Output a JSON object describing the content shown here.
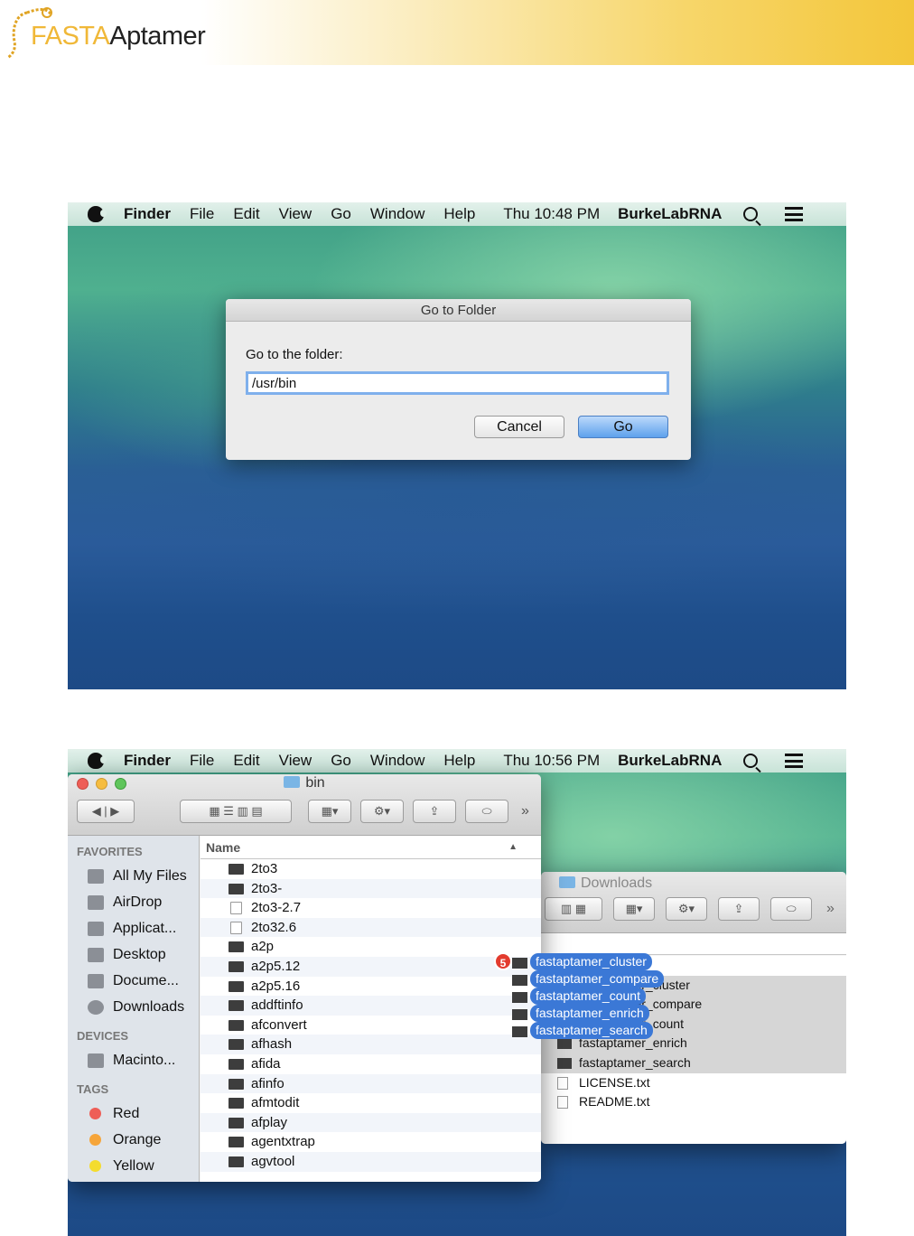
{
  "header": {
    "logo_part1": "FASTA",
    "logo_part2": "ptamer",
    "logo_a": "A"
  },
  "shot1": {
    "menubar": {
      "app": "Finder",
      "items": [
        "File",
        "Edit",
        "View",
        "Go",
        "Window",
        "Help"
      ],
      "clock": "Thu 10:48 PM",
      "user": "BurkeLabRNA"
    },
    "dialog": {
      "title": "Go to Folder",
      "label": "Go to the folder:",
      "value": "/usr/bin",
      "cancel": "Cancel",
      "go": "Go"
    }
  },
  "shot2": {
    "menubar": {
      "app": "Finder",
      "items": [
        "File",
        "Edit",
        "View",
        "Go",
        "Window",
        "Help"
      ],
      "clock": "Thu 10:56 PM",
      "user": "BurkeLabRNA"
    },
    "finder": {
      "title": "bin",
      "favorites_label": "FAVORITES",
      "favorites": [
        "All My Files",
        "AirDrop",
        "Applicat...",
        "Desktop",
        "Docume...",
        "Downloads"
      ],
      "devices_label": "DEVICES",
      "devices": [
        "Macinto..."
      ],
      "tags_label": "TAGS",
      "tags": [
        {
          "name": "Red",
          "color": "#ee5e57"
        },
        {
          "name": "Orange",
          "color": "#f6a53a"
        },
        {
          "name": "Yellow",
          "color": "#f4dc2e"
        }
      ],
      "column": "Name",
      "files": [
        "2to3",
        "2to3-",
        "2to3-2.7",
        "2to32.6",
        "a2p",
        "a2p5.12",
        "a2p5.16",
        "addftinfo",
        "afconvert",
        "afhash",
        "afida",
        "afinfo",
        "afmtodit",
        "afplay",
        "agentxtrap",
        "agvtool"
      ]
    },
    "downloads": {
      "title": "Downloads",
      "files": [
        "fastaptamer_cluster",
        "fastaptamer_compare",
        "fastaptamer_count",
        "fastaptamer_enrich",
        "fastaptamer_search",
        "LICENSE.txt",
        "README.txt"
      ]
    },
    "drag": {
      "count": "5",
      "items": [
        "fastaptamer_cluster",
        "fastaptamer_compare",
        "fastaptamer_count",
        "fastaptamer_enrich",
        "fastaptamer_search"
      ]
    }
  }
}
